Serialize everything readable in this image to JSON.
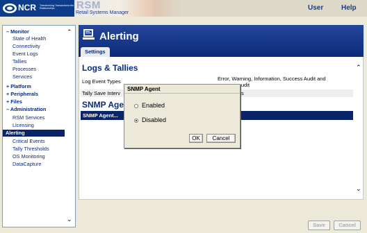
{
  "header": {
    "brand": "NCR",
    "brand_tagline": "Transforming Transactions into Relationships",
    "product": "RSM",
    "product_subtitle": "Retail Systems Manager",
    "user_link": "User",
    "help_link": "Help"
  },
  "sidebar": {
    "items": [
      {
        "label": "– Monitor"
      },
      {
        "label": "State of Health"
      },
      {
        "label": "Connectivity"
      },
      {
        "label": "Event Logs"
      },
      {
        "label": "Tallies"
      },
      {
        "label": "Processes"
      },
      {
        "label": "Services"
      },
      {
        "label": "+ Platform"
      },
      {
        "label": "+ Peripherals"
      },
      {
        "label": "+ Files"
      },
      {
        "label": "– Administration"
      },
      {
        "label": "RSM Services"
      },
      {
        "label": "Licensing"
      },
      {
        "label": "Alerting"
      },
      {
        "label": "Critical Events"
      },
      {
        "label": "Tally Thresholds"
      },
      {
        "label": "OS Monitoring"
      },
      {
        "label": "DataCapture"
      }
    ]
  },
  "page": {
    "title": "Alerting",
    "tab": "Settings"
  },
  "logs_section": {
    "title": "Logs & Tallies",
    "log_event_types_label": "Log Event Types",
    "log_event_types_value_line1": "Error, Warning, Information, Success Audit and",
    "log_event_types_value_line2": "udit",
    "tally_save_label": "Tally Save Interv",
    "tally_save_value": "s"
  },
  "snmp_section": {
    "title": "SNMP Agen",
    "agent_link": "SNMP Agent..."
  },
  "buttons": {
    "save": "Save",
    "cancel": "Cancel"
  },
  "dialog": {
    "title": "SNMP Agent",
    "options": [
      {
        "label": "Enabled",
        "checked": false
      },
      {
        "label": "Disabled",
        "checked": true
      }
    ],
    "ok": "OK",
    "cancel": "Cancel"
  },
  "colors": {
    "brand_navy": "#0d3c8a",
    "header_blue": "#1a3c8f",
    "selection": "#0a246a",
    "background": "#ece9d8"
  },
  "icons": [
    "ncr-logo-icon",
    "alerting-monitor-icon",
    "scroll-up-arrow",
    "scroll-down-arrow"
  ]
}
